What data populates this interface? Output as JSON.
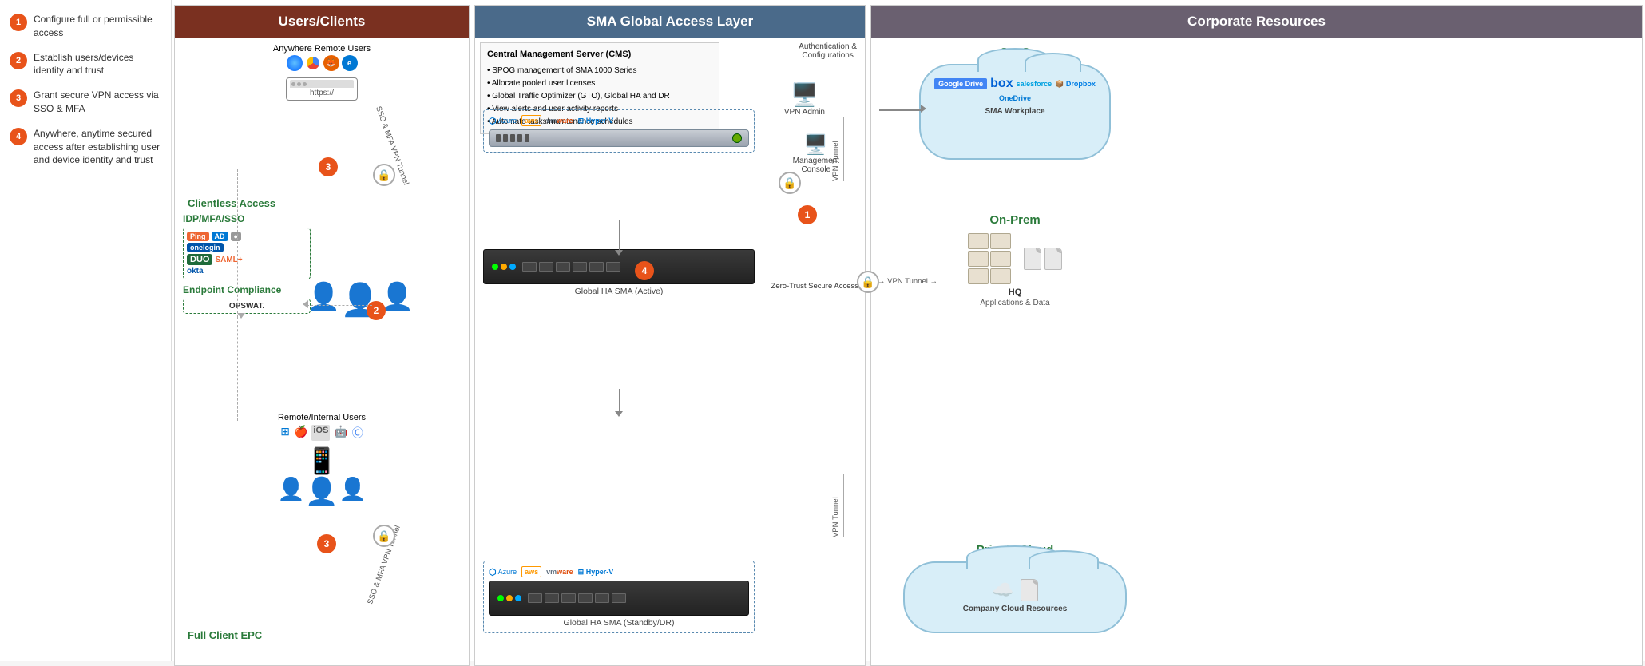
{
  "sidebar": {
    "items": [
      {
        "num": "1",
        "text": "Configure full or permissible access"
      },
      {
        "num": "2",
        "text": "Establish users/devices identity and trust"
      },
      {
        "num": "3",
        "text": "Grant secure VPN access via SSO & MFA"
      },
      {
        "num": "4",
        "text": "Anywhere, anytime secured access after establishing user and device identity and trust"
      }
    ]
  },
  "users_clients": {
    "title": "Users/Clients",
    "anywhere_label": "Anywhere Remote Users",
    "clientless_label": "Clientless Access",
    "https_url": "https://",
    "idp_title": "IDP/MFA/SSO",
    "idp_logos": [
      "Ping",
      "AD",
      "●",
      "onelogin",
      "DUO",
      "SAML",
      "okta"
    ],
    "endpoint_title": "Endpoint Compliance",
    "endpoint_logo": "OPSWAT.",
    "remote_label": "Remote/Internal Users",
    "full_client_label": "Full Client EPC",
    "badge_3a": "3",
    "badge_2": "2",
    "badge_3b": "3",
    "sso_mfa_label_top": "SSO & MFA VPN Tunnel",
    "sso_mfa_label_bot": "SSO & MFA VPN Tunnel"
  },
  "sma": {
    "title": "SMA Global Access Layer",
    "cms_title": "Central Management Server (CMS)",
    "cms_bullets": [
      "SPOG management of SMA 1000 Series",
      "Allocate pooled user licenses",
      "Global Traffic Optimizer (GTO), Global HA and DR",
      "View alerts and user activity reports",
      "Automate tasks/maintenance schedules"
    ],
    "auth_label": "Authentication &\nConfigurations",
    "vpn_admin_label": "VPN Admin",
    "mgmt_console_label": "Management\nConsole",
    "badge_1": "1",
    "badge_4": "4",
    "global_ha_active_label": "Global HA SMA (Active)",
    "global_ha_standby_label": "Global HA SMA (Standby/DR)",
    "zero_trust_label": "Zero-Trust Secure Access",
    "cloud_logos_top": [
      "Azure",
      "aws",
      "VMware",
      "Hyper-V"
    ],
    "cloud_logos_bot": [
      "Azure",
      "aws",
      "VMware",
      "Hyper-V"
    ]
  },
  "corporate": {
    "title": "Corporate Resources",
    "saas_label": "SaaS",
    "saas_workplace_label": "SMA Workplace",
    "saas_apps": [
      "Google Drive",
      "box",
      "Salesforce",
      "Dropbox",
      "OneDrive"
    ],
    "onprem_label": "On-Prem",
    "hq_label": "HQ",
    "hq_data_label": "Applications & Data",
    "private_cloud_label": "Private Cloud",
    "company_cloud_label": "Company Cloud Resources",
    "vpn_tunnel_label1": "VPN Tunnel",
    "vpn_tunnel_label2": "VPN Tunnel",
    "vpn_tunnel_label3": "VPN Tunnel"
  }
}
